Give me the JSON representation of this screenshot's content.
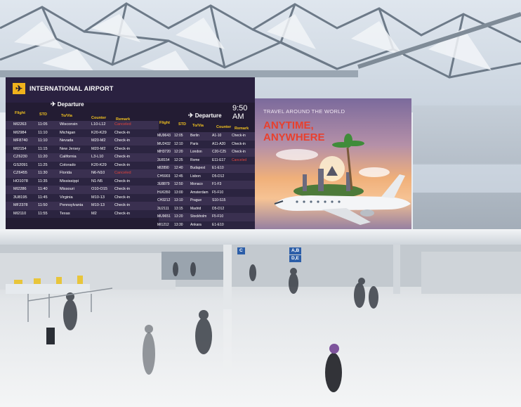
{
  "board": {
    "title": "INTERNATIONAL AIRPORT",
    "departure_left": "Departure",
    "departure_right": "Departure",
    "time": "9:50 AM",
    "headers_left": [
      "Flight",
      "STD",
      "To/Via",
      "Counter",
      "Remark"
    ],
    "headers_right": [
      "Flight",
      "STD",
      "To/Via",
      "Counter",
      "Remark"
    ],
    "left_rows": [
      {
        "flight": "MI2263",
        "std": "11:05",
        "to": "Wisconsin",
        "counter": "L10-L12",
        "remark": "Canceled"
      },
      {
        "flight": "MI2984",
        "std": "11:10",
        "to": "Michigan",
        "counter": "K20-K29",
        "remark": "Check-in"
      },
      {
        "flight": "MF8740",
        "std": "11:10",
        "to": "Nevada",
        "counter": "M20-M2",
        "remark": "Check-in"
      },
      {
        "flight": "MI2154",
        "std": "11:15",
        "to": "New Jersey",
        "counter": "M20-M2",
        "remark": "Check-in"
      },
      {
        "flight": "CZ6230",
        "std": "11:20",
        "to": "California",
        "counter": "L3-L10",
        "remark": "Check-in"
      },
      {
        "flight": "GS2091",
        "std": "11:25",
        "to": "Colorado",
        "counter": "K20-K29",
        "remark": "Check-in"
      },
      {
        "flight": "CZ6455",
        "std": "11:30",
        "to": "Florida",
        "counter": "N6-N10",
        "remark": "Canceled"
      },
      {
        "flight": "HO1078",
        "std": "11:35",
        "to": "Mississippi",
        "counter": "N1-N5",
        "remark": "Check-in"
      },
      {
        "flight": "MI2286",
        "std": "11:40",
        "to": "Missouri",
        "counter": "O10-O15",
        "remark": "Check-in"
      },
      {
        "flight": "3U8195",
        "std": "11:45",
        "to": "Virginia",
        "counter": "M10-13",
        "remark": "Check-in"
      },
      {
        "flight": "MF2378",
        "std": "11:50",
        "to": "Pennsylvania",
        "counter": "M10-13",
        "remark": "Check-in"
      },
      {
        "flight": "MI2110",
        "std": "11:55",
        "to": "Texas",
        "counter": "M2",
        "remark": "Check-in"
      }
    ],
    "right_rows": [
      {
        "flight": "MU9643",
        "std": "12:05",
        "to": "Berlin",
        "counter": "A1-10",
        "remark": "Check-in"
      },
      {
        "flight": "MU2432",
        "std": "12:10",
        "to": "Paris",
        "counter": "A11-A20",
        "remark": "Check-in"
      },
      {
        "flight": "MH3720",
        "std": "12:20",
        "to": "London",
        "counter": "C20-C25",
        "remark": "Check-in"
      },
      {
        "flight": "3U8154",
        "std": "12:25",
        "to": "Rome",
        "counter": "E11-E17",
        "remark": "Canceled"
      },
      {
        "flight": "MI2890",
        "std": "12:40",
        "to": "Budapest",
        "counter": "E1-E10",
        "remark": ""
      },
      {
        "flight": "CH5903",
        "std": "12:45",
        "to": "Lisbon",
        "counter": "D5-D12",
        "remark": ""
      },
      {
        "flight": "3U8879",
        "std": "12:50",
        "to": "Monaco",
        "counter": "F1-F3",
        "remark": ""
      },
      {
        "flight": "HU6350",
        "std": "13:00",
        "to": "Amsterdam",
        "counter": "F5-F10",
        "remark": ""
      },
      {
        "flight": "CH3212",
        "std": "13:10",
        "to": "Prague",
        "counter": "S10-S15",
        "remark": ""
      },
      {
        "flight": "3U2111",
        "std": "13:15",
        "to": "Madrid",
        "counter": "D5-D12",
        "remark": ""
      },
      {
        "flight": "MU9651",
        "std": "13:20",
        "to": "Stockholm",
        "counter": "F5-F10",
        "remark": ""
      },
      {
        "flight": "MI1212",
        "std": "13:30",
        "to": "Ankara",
        "counter": "E1-E10",
        "remark": ""
      }
    ]
  },
  "ad": {
    "subtitle": "TRAVEL AROUND THE WORLD",
    "headline_1": "ANYTIME,",
    "headline_2": "ANYWHERE"
  },
  "signs": [
    "C",
    "A,B",
    "D,E"
  ],
  "colors": {
    "board_bg": "#231c33",
    "header_yellow": "#f0c020",
    "cancel_red": "#e0433b",
    "headline_red": "#e8402e",
    "logo_yellow": "#f0b21c"
  },
  "icons": [
    "airport-logo-icon",
    "plane-icon"
  ]
}
